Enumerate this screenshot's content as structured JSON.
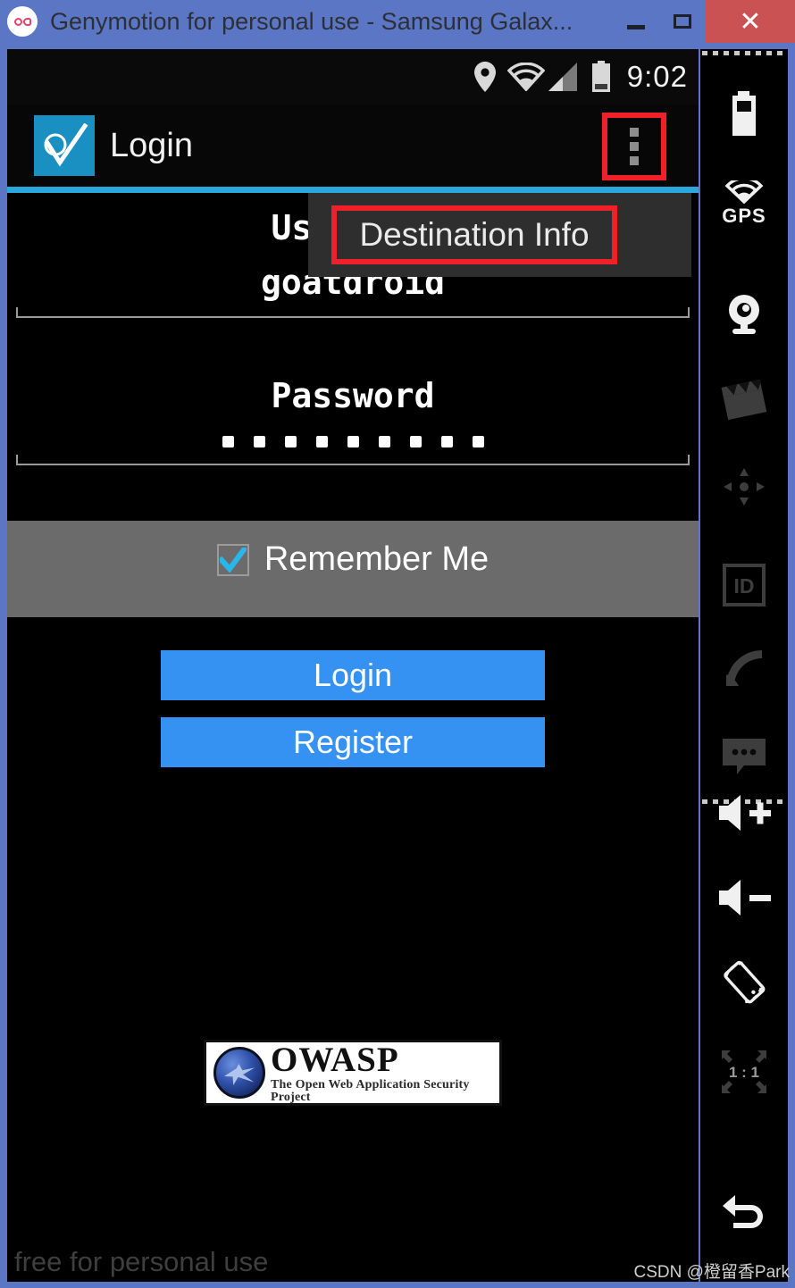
{
  "window": {
    "title": "Genymotion for personal use - Samsung Galax...",
    "app_logo_icon": "genymotion-logo-icon",
    "controls": {
      "minimize_label": "",
      "minimize_icon": "minimize-icon",
      "maximize_label": "",
      "maximize_icon": "maximize-icon",
      "close_label": "✕",
      "close_icon": "close-icon"
    },
    "colors": {
      "titlebar_bg": "#5b76c4",
      "close_bg": "#cb5252",
      "accent_blue": "#2aa7dd",
      "button_blue": "#3592f3",
      "highlight_red": "#ef2028",
      "app_icon_blue": "#1a8fc1"
    }
  },
  "device": {
    "status_bar": {
      "clock": "9:02",
      "icons": [
        "location-pin-icon",
        "wifi-icon",
        "cell-signal-icon",
        "battery-icon"
      ]
    },
    "action_bar": {
      "app_icon": "goatdroid-check-icon",
      "title": "Login",
      "overflow_icon": "overflow-menu-icon"
    },
    "overflow_menu": {
      "items": [
        {
          "label": "Destination Info"
        }
      ]
    },
    "form": {
      "username": {
        "label": "Username",
        "label_visible": "Us",
        "value": "goatdroid"
      },
      "password": {
        "label": "Password",
        "masked_value": "●●●●●●●●●",
        "dot_count": 9
      },
      "remember_me": {
        "label": "Remember Me",
        "checked": true,
        "check_icon": "checkmark-icon"
      }
    },
    "buttons": {
      "login_label": "Login",
      "register_label": "Register"
    },
    "footer_logo": {
      "title": "OWASP",
      "tagline": "The Open Web Application Security Project",
      "globe_icon": "owasp-globe-icon"
    },
    "watermark_free": "free for personal use"
  },
  "toolbar": {
    "items": [
      {
        "name": "battery-icon",
        "label": ""
      },
      {
        "name": "gps-icon",
        "label": "GPS"
      },
      {
        "name": "webcam-icon",
        "label": ""
      },
      {
        "name": "video-clapper-icon",
        "label": ""
      },
      {
        "name": "dpad-icon",
        "label": ""
      },
      {
        "name": "id-icon",
        "label": "ID"
      },
      {
        "name": "baseband-signal-icon",
        "label": ""
      },
      {
        "name": "sms-icon",
        "label": ""
      },
      {
        "name": "volume-up-icon",
        "label": ""
      },
      {
        "name": "volume-down-icon",
        "label": ""
      },
      {
        "name": "rotate-screen-icon",
        "label": ""
      },
      {
        "name": "zoom-one-to-one-icon",
        "label": "1 : 1"
      },
      {
        "name": "back-arrow-icon",
        "label": ""
      }
    ]
  },
  "watermark": "CSDN @橙留香Park"
}
